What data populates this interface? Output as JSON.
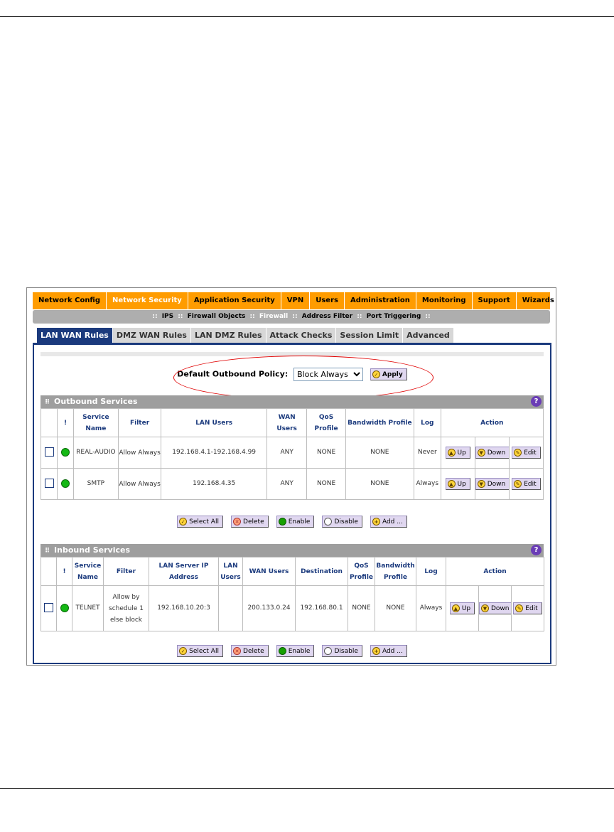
{
  "topnav": [
    {
      "label": "Network Config",
      "active": false
    },
    {
      "label": "Network Security",
      "active": true
    },
    {
      "label": "Application Security",
      "active": false
    },
    {
      "label": "VPN",
      "active": false
    },
    {
      "label": "Users",
      "active": false
    },
    {
      "label": "Administration",
      "active": false
    },
    {
      "label": "Monitoring",
      "active": false
    },
    {
      "label": "Support",
      "active": false
    },
    {
      "label": "Wizards",
      "active": false
    }
  ],
  "subnav": {
    "sep": "::",
    "items": [
      "IPS",
      "Firewall Objects",
      "Firewall",
      "Address Filter",
      "Port Triggering"
    ],
    "current": "Firewall"
  },
  "tabs": [
    "LAN WAN Rules",
    "DMZ WAN Rules",
    "LAN DMZ Rules",
    "Attack Checks",
    "Session Limit",
    "Advanced"
  ],
  "policy": {
    "label": "Default Outbound Policy:",
    "selected": "Block Always",
    "apply_label": "Apply"
  },
  "outbound": {
    "title": "Outbound Services",
    "headers": {
      "excl": "!",
      "service": "Service Name",
      "filter": "Filter",
      "lan_users": "LAN Users",
      "wan_users": "WAN Users",
      "qos": "QoS Profile",
      "bandwidth": "Bandwidth Profile",
      "log": "Log",
      "action": "Action"
    },
    "rows": [
      {
        "service": "REAL-AUDIO",
        "filter": "Allow Always",
        "lan_users": "192.168.4.1-192.168.4.99",
        "wan_users": "ANY",
        "qos": "NONE",
        "bandwidth": "NONE",
        "log": "Never"
      },
      {
        "service": "SMTP",
        "filter": "Allow Always",
        "lan_users": "192.168.4.35",
        "wan_users": "ANY",
        "qos": "NONE",
        "bandwidth": "NONE",
        "log": "Always"
      }
    ]
  },
  "inbound": {
    "title": "Inbound Services",
    "headers": {
      "excl": "!",
      "service": "Service Name",
      "filter": "Filter",
      "lan_server": "LAN Server IP Address",
      "lan_users": "LAN Users",
      "wan_users": "WAN Users",
      "destination": "Destination",
      "qos": "QoS Profile",
      "bandwidth": "Bandwidth Profile",
      "log": "Log",
      "action": "Action"
    },
    "rows": [
      {
        "service": "TELNET",
        "filter": "Allow by schedule 1 else block",
        "lan_server": "192.168.10.20:3",
        "lan_users": "",
        "wan_users": "200.133.0.24",
        "destination": "192.168.80.1",
        "qos": "NONE",
        "bandwidth": "NONE",
        "log": "Always"
      }
    ]
  },
  "row_buttons": {
    "up": "Up",
    "down": "Down",
    "edit": "Edit"
  },
  "bulk_buttons": {
    "select_all": "Select All",
    "delete": "Delete",
    "enable": "Enable",
    "disable": "Disable",
    "add": "Add ..."
  },
  "help_glyph": "?",
  "colors": {
    "nav_orange": "#ff9c00",
    "tab_active": "#1b3a7d",
    "highlight_ellipse": "#e00000",
    "status_green": "#14b814"
  }
}
